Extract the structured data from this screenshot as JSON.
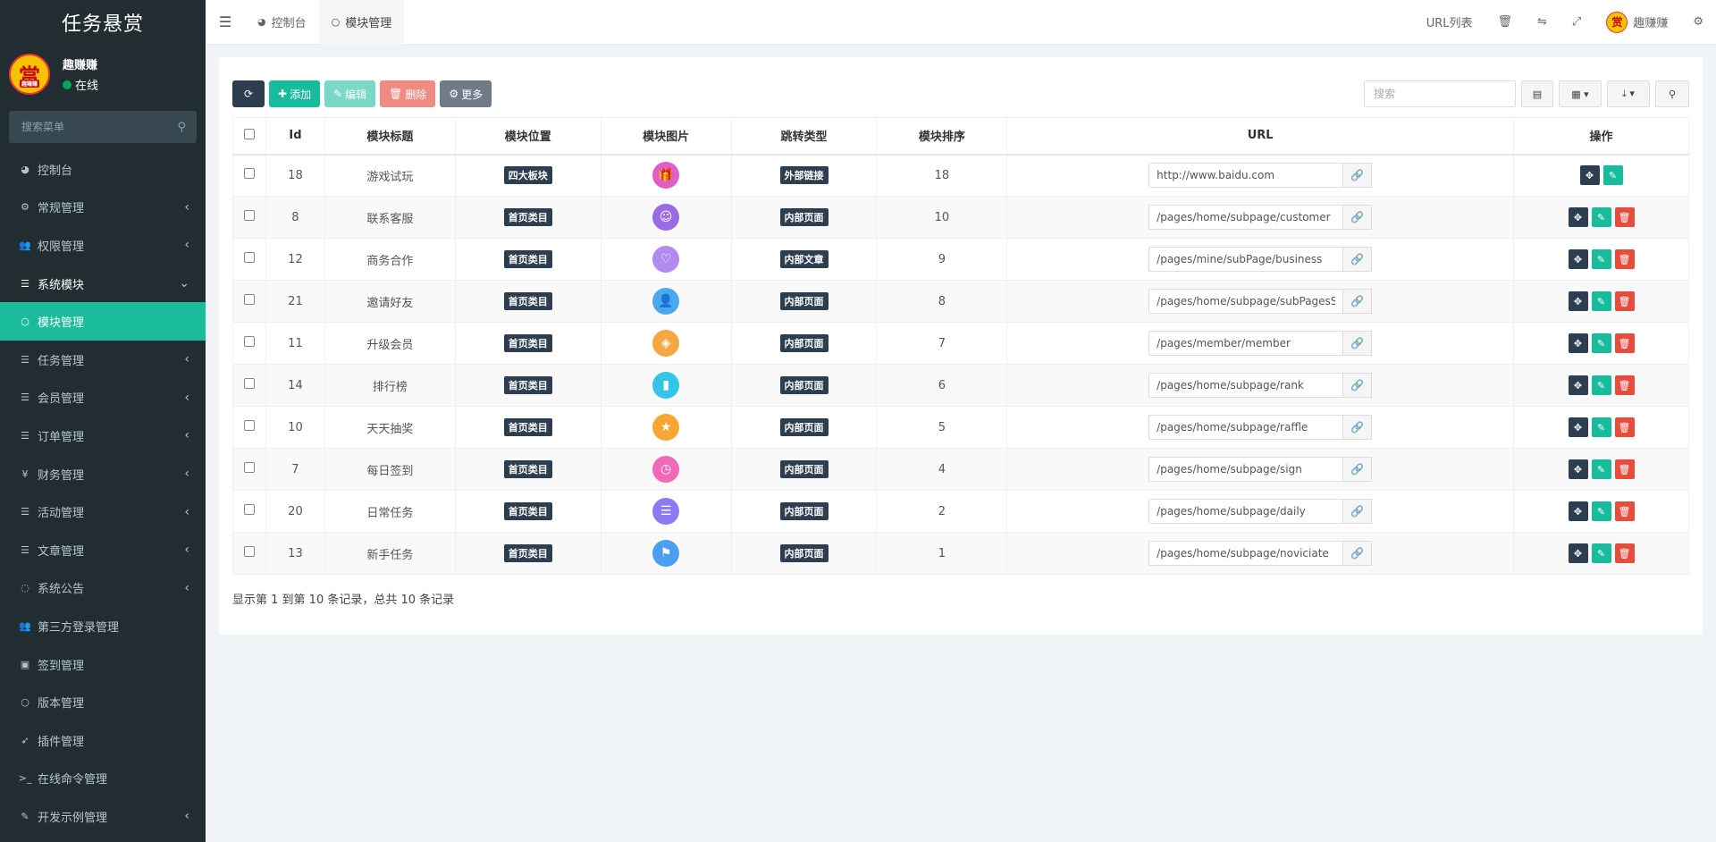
{
  "app": {
    "title": "任务悬赏"
  },
  "user": {
    "name": "趣赚赚",
    "status": "在线",
    "avatar_text": "赏",
    "avatar_sub": "趣赚赚"
  },
  "sidebar": {
    "search_placeholder": "搜索菜单",
    "items": [
      {
        "label": "控制台",
        "icon": "dashboard-icon",
        "glyph": "◕",
        "arrow": ""
      },
      {
        "label": "常规管理",
        "icon": "cogs-icon",
        "glyph": "⚙",
        "arrow": "‹"
      },
      {
        "label": "权限管理",
        "icon": "group-icon",
        "glyph": "👥",
        "arrow": "‹"
      },
      {
        "label": "系统模块",
        "icon": "list-icon",
        "glyph": "☰",
        "arrow": "⌄"
      },
      {
        "label": "模块管理",
        "icon": "circle-icon",
        "glyph": "○",
        "arrow": ""
      },
      {
        "label": "任务管理",
        "icon": "list-icon",
        "glyph": "☰",
        "arrow": "‹"
      },
      {
        "label": "会员管理",
        "icon": "list-icon",
        "glyph": "☰",
        "arrow": "‹"
      },
      {
        "label": "订单管理",
        "icon": "list-icon",
        "glyph": "☰",
        "arrow": "‹"
      },
      {
        "label": "财务管理",
        "icon": "yen-icon",
        "glyph": "¥",
        "arrow": "‹"
      },
      {
        "label": "活动管理",
        "icon": "list-icon",
        "glyph": "☰",
        "arrow": "‹"
      },
      {
        "label": "文章管理",
        "icon": "list-icon",
        "glyph": "☰",
        "arrow": "‹"
      },
      {
        "label": "系统公告",
        "icon": "comment-icon",
        "glyph": "◌",
        "arrow": "‹"
      },
      {
        "label": "第三方登录管理",
        "icon": "group-icon",
        "glyph": "👥",
        "arrow": ""
      },
      {
        "label": "签到管理",
        "icon": "calendar-check-icon",
        "glyph": "▣",
        "arrow": ""
      },
      {
        "label": "版本管理",
        "icon": "circle-icon",
        "glyph": "○",
        "arrow": ""
      },
      {
        "label": "插件管理",
        "icon": "rocket-icon",
        "glyph": "➶",
        "arrow": ""
      },
      {
        "label": "在线命令管理",
        "icon": "terminal-icon",
        "glyph": ">_",
        "arrow": ""
      },
      {
        "label": "开发示例管理",
        "icon": "magic-icon",
        "glyph": "✎",
        "arrow": "‹"
      }
    ]
  },
  "topbar": {
    "tabs": [
      {
        "label": "控制台",
        "glyph": "◕"
      },
      {
        "label": "模块管理",
        "glyph": "○"
      }
    ],
    "url_list": "URL列表",
    "username": "趣赚赚"
  },
  "toolbar": {
    "add": "添加",
    "edit": "编辑",
    "delete": "删除",
    "more": "更多",
    "search_placeholder": "搜索"
  },
  "table": {
    "headers": [
      "Id",
      "模块标题",
      "模块位置",
      "模块图片",
      "跳转类型",
      "模块排序",
      "URL",
      "操作"
    ],
    "rows": [
      {
        "id": "18",
        "title": "游戏试玩",
        "position": "四大板块",
        "image_color": "#e05fc7",
        "image_glyph": "🎁",
        "jump": "外部链接",
        "sort": "18",
        "url": "http://www.baidu.com",
        "delete": false
      },
      {
        "id": "8",
        "title": "联系客服",
        "position": "首页类目",
        "image_color": "#9b6be6",
        "image_glyph": "☺",
        "jump": "内部页面",
        "sort": "10",
        "url": "/pages/home/subpage/customer",
        "delete": true
      },
      {
        "id": "12",
        "title": "商务合作",
        "position": "首页类目",
        "image_color": "#b28bf0",
        "image_glyph": "♡",
        "jump": "内部文章",
        "sort": "9",
        "url": "/pages/mine/subPage/business",
        "delete": true
      },
      {
        "id": "21",
        "title": "邀请好友",
        "position": "首页类目",
        "image_color": "#4aa8f0",
        "image_glyph": "👤",
        "jump": "内部页面",
        "sort": "8",
        "url": "/pages/home/subpage/subPagesSha",
        "delete": true
      },
      {
        "id": "11",
        "title": "升级会员",
        "position": "首页类目",
        "image_color": "#f5a742",
        "image_glyph": "◈",
        "jump": "内部页面",
        "sort": "7",
        "url": "/pages/member/member",
        "delete": true
      },
      {
        "id": "14",
        "title": "排行榜",
        "position": "首页类目",
        "image_color": "#33c4e6",
        "image_glyph": "▮",
        "jump": "内部页面",
        "sort": "6",
        "url": "/pages/home/subpage/rank",
        "delete": true
      },
      {
        "id": "10",
        "title": "天天抽奖",
        "position": "首页类目",
        "image_color": "#f7a634",
        "image_glyph": "★",
        "jump": "内部页面",
        "sort": "5",
        "url": "/pages/home/subpage/raffle",
        "delete": true
      },
      {
        "id": "7",
        "title": "每日签到",
        "position": "首页类目",
        "image_color": "#f06ab8",
        "image_glyph": "◷",
        "jump": "内部页面",
        "sort": "4",
        "url": "/pages/home/subpage/sign",
        "delete": true
      },
      {
        "id": "20",
        "title": "日常任务",
        "position": "首页类目",
        "image_color": "#8a7cf0",
        "image_glyph": "☰",
        "jump": "内部页面",
        "sort": "2",
        "url": "/pages/home/subpage/daily",
        "delete": true
      },
      {
        "id": "13",
        "title": "新手任务",
        "position": "首页类目",
        "image_color": "#4a9ff0",
        "image_glyph": "⚑",
        "jump": "内部页面",
        "sort": "1",
        "url": "/pages/home/subpage/noviciate",
        "delete": true
      }
    ]
  },
  "pager": {
    "summary": "显示第 1 到第 10 条记录，总共 10 条记录"
  }
}
